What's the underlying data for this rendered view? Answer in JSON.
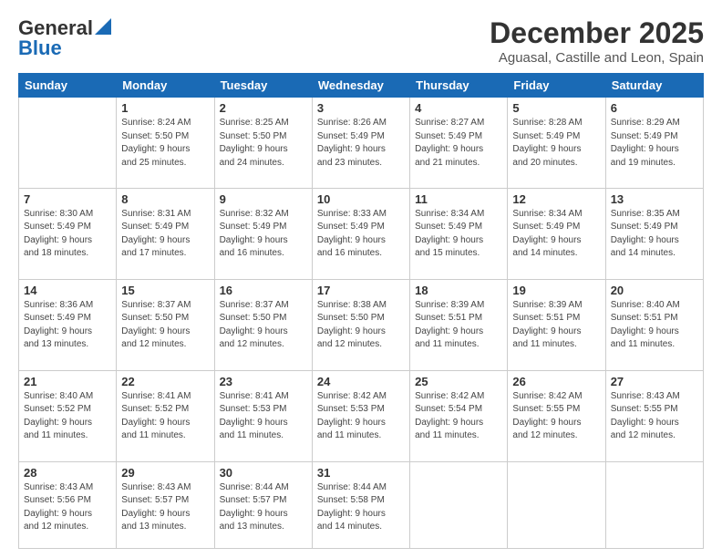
{
  "logo": {
    "line1": "General",
    "line2": "Blue"
  },
  "header": {
    "month": "December 2025",
    "location": "Aguasal, Castille and Leon, Spain"
  },
  "weekdays": [
    "Sunday",
    "Monday",
    "Tuesday",
    "Wednesday",
    "Thursday",
    "Friday",
    "Saturday"
  ],
  "weeks": [
    [
      {
        "day": "",
        "info": ""
      },
      {
        "day": "1",
        "info": "Sunrise: 8:24 AM\nSunset: 5:50 PM\nDaylight: 9 hours\nand 25 minutes."
      },
      {
        "day": "2",
        "info": "Sunrise: 8:25 AM\nSunset: 5:50 PM\nDaylight: 9 hours\nand 24 minutes."
      },
      {
        "day": "3",
        "info": "Sunrise: 8:26 AM\nSunset: 5:49 PM\nDaylight: 9 hours\nand 23 minutes."
      },
      {
        "day": "4",
        "info": "Sunrise: 8:27 AM\nSunset: 5:49 PM\nDaylight: 9 hours\nand 21 minutes."
      },
      {
        "day": "5",
        "info": "Sunrise: 8:28 AM\nSunset: 5:49 PM\nDaylight: 9 hours\nand 20 minutes."
      },
      {
        "day": "6",
        "info": "Sunrise: 8:29 AM\nSunset: 5:49 PM\nDaylight: 9 hours\nand 19 minutes."
      }
    ],
    [
      {
        "day": "7",
        "info": "Sunrise: 8:30 AM\nSunset: 5:49 PM\nDaylight: 9 hours\nand 18 minutes."
      },
      {
        "day": "8",
        "info": "Sunrise: 8:31 AM\nSunset: 5:49 PM\nDaylight: 9 hours\nand 17 minutes."
      },
      {
        "day": "9",
        "info": "Sunrise: 8:32 AM\nSunset: 5:49 PM\nDaylight: 9 hours\nand 16 minutes."
      },
      {
        "day": "10",
        "info": "Sunrise: 8:33 AM\nSunset: 5:49 PM\nDaylight: 9 hours\nand 16 minutes."
      },
      {
        "day": "11",
        "info": "Sunrise: 8:34 AM\nSunset: 5:49 PM\nDaylight: 9 hours\nand 15 minutes."
      },
      {
        "day": "12",
        "info": "Sunrise: 8:34 AM\nSunset: 5:49 PM\nDaylight: 9 hours\nand 14 minutes."
      },
      {
        "day": "13",
        "info": "Sunrise: 8:35 AM\nSunset: 5:49 PM\nDaylight: 9 hours\nand 14 minutes."
      }
    ],
    [
      {
        "day": "14",
        "info": "Sunrise: 8:36 AM\nSunset: 5:49 PM\nDaylight: 9 hours\nand 13 minutes."
      },
      {
        "day": "15",
        "info": "Sunrise: 8:37 AM\nSunset: 5:50 PM\nDaylight: 9 hours\nand 12 minutes."
      },
      {
        "day": "16",
        "info": "Sunrise: 8:37 AM\nSunset: 5:50 PM\nDaylight: 9 hours\nand 12 minutes."
      },
      {
        "day": "17",
        "info": "Sunrise: 8:38 AM\nSunset: 5:50 PM\nDaylight: 9 hours\nand 12 minutes."
      },
      {
        "day": "18",
        "info": "Sunrise: 8:39 AM\nSunset: 5:51 PM\nDaylight: 9 hours\nand 11 minutes."
      },
      {
        "day": "19",
        "info": "Sunrise: 8:39 AM\nSunset: 5:51 PM\nDaylight: 9 hours\nand 11 minutes."
      },
      {
        "day": "20",
        "info": "Sunrise: 8:40 AM\nSunset: 5:51 PM\nDaylight: 9 hours\nand 11 minutes."
      }
    ],
    [
      {
        "day": "21",
        "info": "Sunrise: 8:40 AM\nSunset: 5:52 PM\nDaylight: 9 hours\nand 11 minutes."
      },
      {
        "day": "22",
        "info": "Sunrise: 8:41 AM\nSunset: 5:52 PM\nDaylight: 9 hours\nand 11 minutes."
      },
      {
        "day": "23",
        "info": "Sunrise: 8:41 AM\nSunset: 5:53 PM\nDaylight: 9 hours\nand 11 minutes."
      },
      {
        "day": "24",
        "info": "Sunrise: 8:42 AM\nSunset: 5:53 PM\nDaylight: 9 hours\nand 11 minutes."
      },
      {
        "day": "25",
        "info": "Sunrise: 8:42 AM\nSunset: 5:54 PM\nDaylight: 9 hours\nand 11 minutes."
      },
      {
        "day": "26",
        "info": "Sunrise: 8:42 AM\nSunset: 5:55 PM\nDaylight: 9 hours\nand 12 minutes."
      },
      {
        "day": "27",
        "info": "Sunrise: 8:43 AM\nSunset: 5:55 PM\nDaylight: 9 hours\nand 12 minutes."
      }
    ],
    [
      {
        "day": "28",
        "info": "Sunrise: 8:43 AM\nSunset: 5:56 PM\nDaylight: 9 hours\nand 12 minutes."
      },
      {
        "day": "29",
        "info": "Sunrise: 8:43 AM\nSunset: 5:57 PM\nDaylight: 9 hours\nand 13 minutes."
      },
      {
        "day": "30",
        "info": "Sunrise: 8:44 AM\nSunset: 5:57 PM\nDaylight: 9 hours\nand 13 minutes."
      },
      {
        "day": "31",
        "info": "Sunrise: 8:44 AM\nSunset: 5:58 PM\nDaylight: 9 hours\nand 14 minutes."
      },
      {
        "day": "",
        "info": ""
      },
      {
        "day": "",
        "info": ""
      },
      {
        "day": "",
        "info": ""
      }
    ]
  ]
}
